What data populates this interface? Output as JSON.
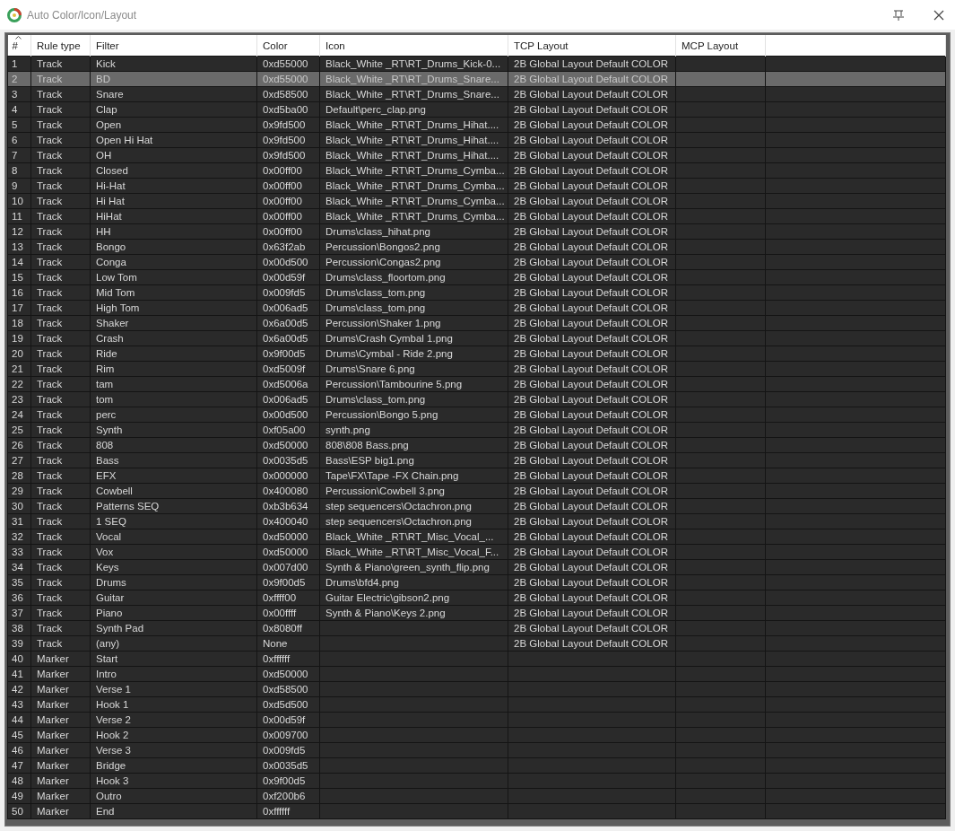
{
  "window": {
    "title": "Auto Color/Icon/Layout"
  },
  "table": {
    "columns": [
      {
        "label": "#",
        "sorted": true
      },
      {
        "label": "Rule type",
        "sorted": false
      },
      {
        "label": "Filter",
        "sorted": false
      },
      {
        "label": "Color",
        "sorted": false
      },
      {
        "label": "Icon",
        "sorted": false
      },
      {
        "label": "TCP Layout",
        "sorted": false
      },
      {
        "label": "MCP Layout",
        "sorted": false
      }
    ],
    "rows": [
      {
        "number": "1",
        "rule_type": "Track",
        "filter": "Kick",
        "color_value": "0xd55000",
        "icon": "Black_White _RT\\RT_Drums_Kick-0...",
        "tcp_layout": "2B Global Layout Default COLOR",
        "selected": false
      },
      {
        "number": "2",
        "rule_type": "Track",
        "filter": "BD",
        "color_value": "0xd55000",
        "icon": "Black_White _RT\\RT_Drums_Snare...",
        "tcp_layout": "2B Global Layout Default COLOR",
        "selected": true
      },
      {
        "number": "3",
        "rule_type": "Track",
        "filter": "Snare",
        "color_value": "0xd58500",
        "icon": "Black_White _RT\\RT_Drums_Snare...",
        "tcp_layout": "2B Global Layout Default COLOR",
        "selected": false
      },
      {
        "number": "4",
        "rule_type": "Track",
        "filter": "Clap",
        "color_value": "0xd5ba00",
        "icon": "Default\\perc_clap.png",
        "tcp_layout": "2B Global Layout Default COLOR",
        "selected": false
      },
      {
        "number": "5",
        "rule_type": "Track",
        "filter": "Open",
        "color_value": "0x9fd500",
        "icon": "Black_White _RT\\RT_Drums_Hihat....",
        "tcp_layout": "2B Global Layout Default COLOR",
        "selected": false
      },
      {
        "number": "6",
        "rule_type": "Track",
        "filter": "Open Hi Hat",
        "color_value": "0x9fd500",
        "icon": "Black_White _RT\\RT_Drums_Hihat....",
        "tcp_layout": "2B Global Layout Default COLOR",
        "selected": false
      },
      {
        "number": "7",
        "rule_type": "Track",
        "filter": "OH",
        "color_value": "0x9fd500",
        "icon": "Black_White _RT\\RT_Drums_Hihat....",
        "tcp_layout": "2B Global Layout Default COLOR",
        "selected": false
      },
      {
        "number": "8",
        "rule_type": "Track",
        "filter": "Closed",
        "color_value": "0x00ff00",
        "icon": "Black_White _RT\\RT_Drums_Cymba...",
        "tcp_layout": "2B Global Layout Default COLOR",
        "selected": false
      },
      {
        "number": "9",
        "rule_type": "Track",
        "filter": "Hi-Hat",
        "color_value": "0x00ff00",
        "icon": "Black_White _RT\\RT_Drums_Cymba...",
        "tcp_layout": "2B Global Layout Default COLOR",
        "selected": false
      },
      {
        "number": "10",
        "rule_type": "Track",
        "filter": "Hi Hat",
        "color_value": "0x00ff00",
        "icon": "Black_White _RT\\RT_Drums_Cymba...",
        "tcp_layout": "2B Global Layout Default COLOR",
        "selected": false
      },
      {
        "number": "11",
        "rule_type": "Track",
        "filter": "HiHat",
        "color_value": "0x00ff00",
        "icon": "Black_White _RT\\RT_Drums_Cymba...",
        "tcp_layout": "2B Global Layout Default COLOR",
        "selected": false
      },
      {
        "number": "12",
        "rule_type": "Track",
        "filter": "HH",
        "color_value": "0x00ff00",
        "icon": "Drums\\class_hihat.png",
        "tcp_layout": "2B Global Layout Default COLOR",
        "selected": false
      },
      {
        "number": "13",
        "rule_type": "Track",
        "filter": "Bongo",
        "color_value": "0x63f2ab",
        "icon": "Percussion\\Bongos2.png",
        "tcp_layout": "2B Global Layout Default COLOR",
        "selected": false
      },
      {
        "number": "14",
        "rule_type": "Track",
        "filter": "Conga",
        "color_value": "0x00d500",
        "icon": "Percussion\\Congas2.png",
        "tcp_layout": "2B Global Layout Default COLOR",
        "selected": false
      },
      {
        "number": "15",
        "rule_type": "Track",
        "filter": "Low Tom",
        "color_value": "0x00d59f",
        "icon": "Drums\\class_floortom.png",
        "tcp_layout": "2B Global Layout Default COLOR",
        "selected": false
      },
      {
        "number": "16",
        "rule_type": "Track",
        "filter": "Mid Tom",
        "color_value": "0x009fd5",
        "icon": "Drums\\class_tom.png",
        "tcp_layout": "2B Global Layout Default COLOR",
        "selected": false
      },
      {
        "number": "17",
        "rule_type": "Track",
        "filter": "High Tom",
        "color_value": "0x006ad5",
        "icon": "Drums\\class_tom.png",
        "tcp_layout": "2B Global Layout Default COLOR",
        "selected": false
      },
      {
        "number": "18",
        "rule_type": "Track",
        "filter": "Shaker",
        "color_value": "0x6a00d5",
        "icon": "Percussion\\Shaker 1.png",
        "tcp_layout": "2B Global Layout Default COLOR",
        "selected": false
      },
      {
        "number": "19",
        "rule_type": "Track",
        "filter": "Crash",
        "color_value": "0x6a00d5",
        "icon": "Drums\\Crash Cymbal 1.png",
        "tcp_layout": "2B Global Layout Default COLOR",
        "selected": false
      },
      {
        "number": "20",
        "rule_type": "Track",
        "filter": "Ride",
        "color_value": "0x9f00d5",
        "icon": "Drums\\Cymbal - Ride 2.png",
        "tcp_layout": "2B Global Layout Default COLOR",
        "selected": false
      },
      {
        "number": "21",
        "rule_type": "Track",
        "filter": "Rim",
        "color_value": "0xd5009f",
        "icon": "Drums\\Snare 6.png",
        "tcp_layout": "2B Global Layout Default COLOR",
        "selected": false
      },
      {
        "number": "22",
        "rule_type": "Track",
        "filter": "tam",
        "color_value": "0xd5006a",
        "icon": "Percussion\\Tambourine 5.png",
        "tcp_layout": "2B Global Layout Default COLOR",
        "selected": false
      },
      {
        "number": "23",
        "rule_type": "Track",
        "filter": "tom",
        "color_value": "0x006ad5",
        "icon": "Drums\\class_tom.png",
        "tcp_layout": "2B Global Layout Default COLOR",
        "selected": false
      },
      {
        "number": "24",
        "rule_type": "Track",
        "filter": "perc",
        "color_value": "0x00d500",
        "icon": "Percussion\\Bongo 5.png",
        "tcp_layout": "2B Global Layout Default COLOR",
        "selected": false
      },
      {
        "number": "25",
        "rule_type": "Track",
        "filter": "Synth",
        "color_value": "0xf05a00",
        "icon": "synth.png",
        "tcp_layout": "2B Global Layout Default COLOR",
        "selected": false
      },
      {
        "number": "26",
        "rule_type": "Track",
        "filter": "808",
        "color_value": "0xd50000",
        "icon": "808\\808 Bass.png",
        "tcp_layout": "2B Global Layout Default COLOR",
        "selected": false
      },
      {
        "number": "27",
        "rule_type": "Track",
        "filter": "Bass",
        "color_value": "0x0035d5",
        "icon": "Bass\\ESP big1.png",
        "tcp_layout": "2B Global Layout Default COLOR",
        "selected": false
      },
      {
        "number": "28",
        "rule_type": "Track",
        "filter": "EFX",
        "color_value": "0x000000",
        "icon": "Tape\\FX\\Tape -FX Chain.png",
        "tcp_layout": "2B Global Layout Default COLOR",
        "selected": false
      },
      {
        "number": "29",
        "rule_type": "Track",
        "filter": "Cowbell",
        "color_value": "0x400080",
        "icon": "Percussion\\Cowbell 3.png",
        "tcp_layout": "2B Global Layout Default COLOR",
        "selected": false
      },
      {
        "number": "30",
        "rule_type": "Track",
        "filter": "Patterns SEQ",
        "color_value": "0xb3b634",
        "icon": "step sequencers\\Octachron.png",
        "tcp_layout": "2B Global Layout Default COLOR",
        "selected": false
      },
      {
        "number": "31",
        "rule_type": "Track",
        "filter": "1 SEQ",
        "color_value": "0x400040",
        "icon": "step sequencers\\Octachron.png",
        "tcp_layout": "2B Global Layout Default COLOR",
        "selected": false
      },
      {
        "number": "32",
        "rule_type": "Track",
        "filter": "Vocal",
        "color_value": "0xd50000",
        "icon": "Black_White _RT\\RT_Misc_Vocal_...",
        "tcp_layout": "2B Global Layout Default COLOR",
        "selected": false
      },
      {
        "number": "33",
        "rule_type": "Track",
        "filter": "Vox",
        "color_value": "0xd50000",
        "icon": "Black_White _RT\\RT_Misc_Vocal_F...",
        "tcp_layout": "2B Global Layout Default COLOR",
        "selected": false
      },
      {
        "number": "34",
        "rule_type": "Track",
        "filter": "Keys",
        "color_value": "0x007d00",
        "icon": "Synth & Piano\\green_synth_flip.png",
        "tcp_layout": "2B Global Layout Default COLOR",
        "selected": false
      },
      {
        "number": "35",
        "rule_type": "Track",
        "filter": "Drums",
        "color_value": "0x9f00d5",
        "icon": "Drums\\bfd4.png",
        "tcp_layout": "2B Global Layout Default COLOR",
        "selected": false
      },
      {
        "number": "36",
        "rule_type": "Track",
        "filter": "Guitar",
        "color_value": "0xffff00",
        "icon": "Guitar Electric\\gibson2.png",
        "tcp_layout": "2B Global Layout Default COLOR",
        "selected": false
      },
      {
        "number": "37",
        "rule_type": "Track",
        "filter": "Piano",
        "color_value": "0x00ffff",
        "icon": "Synth & Piano\\Keys 2.png",
        "tcp_layout": "2B Global Layout Default COLOR",
        "selected": false
      },
      {
        "number": "38",
        "rule_type": "Track",
        "filter": "Synth Pad",
        "color_value": "0x8080ff",
        "tcp_layout": "2B Global Layout Default COLOR",
        "selected": false
      },
      {
        "number": "39",
        "rule_type": "Track",
        "filter": "(any)",
        "color_value": "None",
        "tcp_layout": "2B Global Layout Default COLOR",
        "selected": false
      },
      {
        "number": "40",
        "rule_type": "Marker",
        "filter": "Start",
        "color_value": "0xffffff",
        "selected": false
      },
      {
        "number": "41",
        "rule_type": "Marker",
        "filter": "Intro",
        "color_value": "0xd50000",
        "selected": false
      },
      {
        "number": "42",
        "rule_type": "Marker",
        "filter": "Verse 1",
        "color_value": "0xd58500",
        "selected": false
      },
      {
        "number": "43",
        "rule_type": "Marker",
        "filter": "Hook 1",
        "color_value": "0xd5d500",
        "selected": false
      },
      {
        "number": "44",
        "rule_type": "Marker",
        "filter": "Verse 2",
        "color_value": "0x00d59f",
        "selected": false
      },
      {
        "number": "45",
        "rule_type": "Marker",
        "filter": "Hook 2",
        "color_value": "0x009700",
        "selected": false
      },
      {
        "number": "46",
        "rule_type": "Marker",
        "filter": "Verse 3",
        "color_value": "0x009fd5",
        "selected": false
      },
      {
        "number": "47",
        "rule_type": "Marker",
        "filter": "Bridge",
        "color_value": "0x0035d5",
        "selected": false
      },
      {
        "number": "48",
        "rule_type": "Marker",
        "filter": "Hook 3",
        "color_value": "0x9f00d5",
        "selected": false
      },
      {
        "number": "49",
        "rule_type": "Marker",
        "filter": "Outro",
        "color_value": "0xf200b6",
        "selected": false
      },
      {
        "number": "50",
        "rule_type": "Marker",
        "filter": "End",
        "color_value": "0xffffff",
        "selected": false
      }
    ]
  }
}
